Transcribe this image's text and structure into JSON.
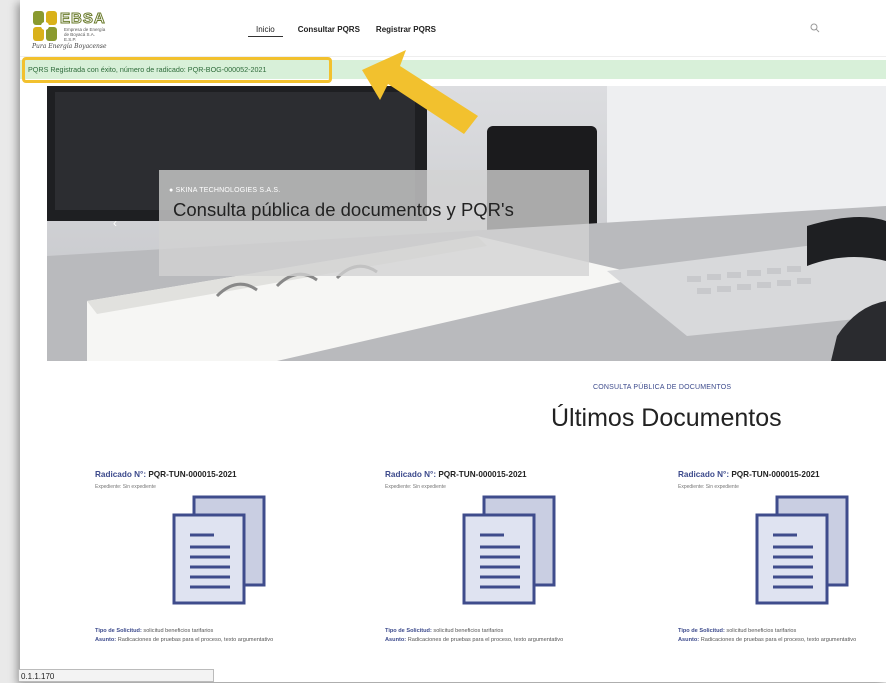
{
  "header": {
    "logo": {
      "name": "EBSA",
      "subtitle": "Empresa de Energía de Boyacá S.A. E.S.P.",
      "tagline": "Pura Energía Boyacense"
    },
    "nav": [
      {
        "label": "Inicio"
      },
      {
        "label": "Consultar PQRS"
      },
      {
        "label": "Registrar PQRS"
      }
    ],
    "search_icon": "search-icon"
  },
  "alert": {
    "text": "PQRS Registrada con éxito, número de radicado: PQR-BOG-000052-2021",
    "highlight_color": "#f2c12e"
  },
  "hero": {
    "company": "SKINA TECHNOLOGIES S.A.S.",
    "title": "Consulta pública de documentos y PQR's",
    "prev_arrow": "‹"
  },
  "section": {
    "kicker": "CONSULTA PÚBLICA DE DOCUMENTOS",
    "title": "Últimos Documentos"
  },
  "cards": [
    {
      "radicado_label": "Radicado N°:",
      "radicado_value": "PQR-TUN-000015-2021",
      "expediente": "Expediente: Sin expediente",
      "tipo_label": "Tipo de Solicitud:",
      "tipo_value": "solicitud beneficios tarifarios",
      "asunto_label": "Asunto:",
      "asunto_value": "Radicaciones de pruebas para el proceso, texto argumentativo"
    },
    {
      "radicado_label": "Radicado N°:",
      "radicado_value": "PQR-TUN-000015-2021",
      "expediente": "Expediente: Sin expediente",
      "tipo_label": "Tipo de Solicitud:",
      "tipo_value": "solicitud beneficios tarifarios",
      "asunto_label": "Asunto:",
      "asunto_value": "Radicaciones de pruebas para el proceso, texto argumentativo"
    },
    {
      "radicado_label": "Radicado N°:",
      "radicado_value": "PQR-TUN-000015-2021",
      "expediente": "Expediente: Sin expediente",
      "tipo_label": "Tipo de Solicitud:",
      "tipo_value": "solicitud beneficios tarifarios",
      "asunto_label": "Asunto:",
      "asunto_value": "Radicaciones de pruebas para el proceso, texto argumentativo"
    }
  ],
  "status_bar": {
    "text": "0.1.1.170"
  },
  "colors": {
    "accent": "#3c4a8c",
    "alert_bg": "#d8f0d9",
    "alert_text": "#2e6b3a",
    "arrow": "#f2c12e"
  }
}
